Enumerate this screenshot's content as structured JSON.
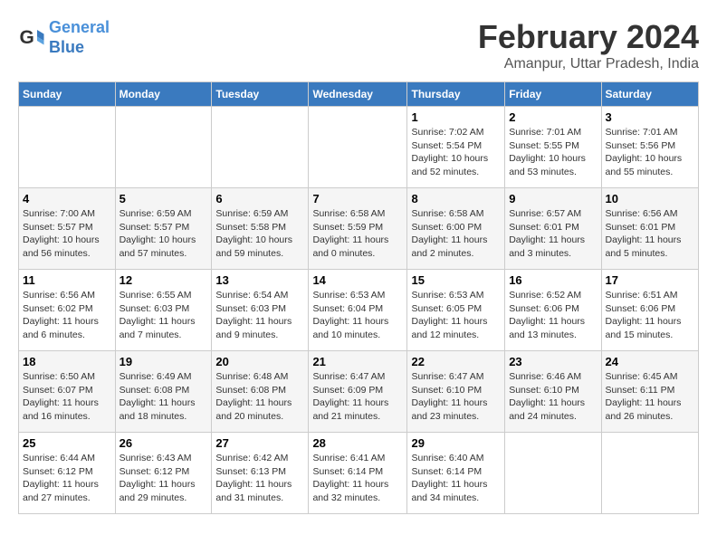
{
  "logo": {
    "line1": "General",
    "line2": "Blue"
  },
  "title": "February 2024",
  "location": "Amanpur, Uttar Pradesh, India",
  "days_of_week": [
    "Sunday",
    "Monday",
    "Tuesday",
    "Wednesday",
    "Thursday",
    "Friday",
    "Saturday"
  ],
  "weeks": [
    [
      {
        "day": "",
        "info": ""
      },
      {
        "day": "",
        "info": ""
      },
      {
        "day": "",
        "info": ""
      },
      {
        "day": "",
        "info": ""
      },
      {
        "day": "1",
        "info": "Sunrise: 7:02 AM\nSunset: 5:54 PM\nDaylight: 10 hours\nand 52 minutes."
      },
      {
        "day": "2",
        "info": "Sunrise: 7:01 AM\nSunset: 5:55 PM\nDaylight: 10 hours\nand 53 minutes."
      },
      {
        "day": "3",
        "info": "Sunrise: 7:01 AM\nSunset: 5:56 PM\nDaylight: 10 hours\nand 55 minutes."
      }
    ],
    [
      {
        "day": "4",
        "info": "Sunrise: 7:00 AM\nSunset: 5:57 PM\nDaylight: 10 hours\nand 56 minutes."
      },
      {
        "day": "5",
        "info": "Sunrise: 6:59 AM\nSunset: 5:57 PM\nDaylight: 10 hours\nand 57 minutes."
      },
      {
        "day": "6",
        "info": "Sunrise: 6:59 AM\nSunset: 5:58 PM\nDaylight: 10 hours\nand 59 minutes."
      },
      {
        "day": "7",
        "info": "Sunrise: 6:58 AM\nSunset: 5:59 PM\nDaylight: 11 hours\nand 0 minutes."
      },
      {
        "day": "8",
        "info": "Sunrise: 6:58 AM\nSunset: 6:00 PM\nDaylight: 11 hours\nand 2 minutes."
      },
      {
        "day": "9",
        "info": "Sunrise: 6:57 AM\nSunset: 6:01 PM\nDaylight: 11 hours\nand 3 minutes."
      },
      {
        "day": "10",
        "info": "Sunrise: 6:56 AM\nSunset: 6:01 PM\nDaylight: 11 hours\nand 5 minutes."
      }
    ],
    [
      {
        "day": "11",
        "info": "Sunrise: 6:56 AM\nSunset: 6:02 PM\nDaylight: 11 hours\nand 6 minutes."
      },
      {
        "day": "12",
        "info": "Sunrise: 6:55 AM\nSunset: 6:03 PM\nDaylight: 11 hours\nand 7 minutes."
      },
      {
        "day": "13",
        "info": "Sunrise: 6:54 AM\nSunset: 6:03 PM\nDaylight: 11 hours\nand 9 minutes."
      },
      {
        "day": "14",
        "info": "Sunrise: 6:53 AM\nSunset: 6:04 PM\nDaylight: 11 hours\nand 10 minutes."
      },
      {
        "day": "15",
        "info": "Sunrise: 6:53 AM\nSunset: 6:05 PM\nDaylight: 11 hours\nand 12 minutes."
      },
      {
        "day": "16",
        "info": "Sunrise: 6:52 AM\nSunset: 6:06 PM\nDaylight: 11 hours\nand 13 minutes."
      },
      {
        "day": "17",
        "info": "Sunrise: 6:51 AM\nSunset: 6:06 PM\nDaylight: 11 hours\nand 15 minutes."
      }
    ],
    [
      {
        "day": "18",
        "info": "Sunrise: 6:50 AM\nSunset: 6:07 PM\nDaylight: 11 hours\nand 16 minutes."
      },
      {
        "day": "19",
        "info": "Sunrise: 6:49 AM\nSunset: 6:08 PM\nDaylight: 11 hours\nand 18 minutes."
      },
      {
        "day": "20",
        "info": "Sunrise: 6:48 AM\nSunset: 6:08 PM\nDaylight: 11 hours\nand 20 minutes."
      },
      {
        "day": "21",
        "info": "Sunrise: 6:47 AM\nSunset: 6:09 PM\nDaylight: 11 hours\nand 21 minutes."
      },
      {
        "day": "22",
        "info": "Sunrise: 6:47 AM\nSunset: 6:10 PM\nDaylight: 11 hours\nand 23 minutes."
      },
      {
        "day": "23",
        "info": "Sunrise: 6:46 AM\nSunset: 6:10 PM\nDaylight: 11 hours\nand 24 minutes."
      },
      {
        "day": "24",
        "info": "Sunrise: 6:45 AM\nSunset: 6:11 PM\nDaylight: 11 hours\nand 26 minutes."
      }
    ],
    [
      {
        "day": "25",
        "info": "Sunrise: 6:44 AM\nSunset: 6:12 PM\nDaylight: 11 hours\nand 27 minutes."
      },
      {
        "day": "26",
        "info": "Sunrise: 6:43 AM\nSunset: 6:12 PM\nDaylight: 11 hours\nand 29 minutes."
      },
      {
        "day": "27",
        "info": "Sunrise: 6:42 AM\nSunset: 6:13 PM\nDaylight: 11 hours\nand 31 minutes."
      },
      {
        "day": "28",
        "info": "Sunrise: 6:41 AM\nSunset: 6:14 PM\nDaylight: 11 hours\nand 32 minutes."
      },
      {
        "day": "29",
        "info": "Sunrise: 6:40 AM\nSunset: 6:14 PM\nDaylight: 11 hours\nand 34 minutes."
      },
      {
        "day": "",
        "info": ""
      },
      {
        "day": "",
        "info": ""
      }
    ]
  ]
}
